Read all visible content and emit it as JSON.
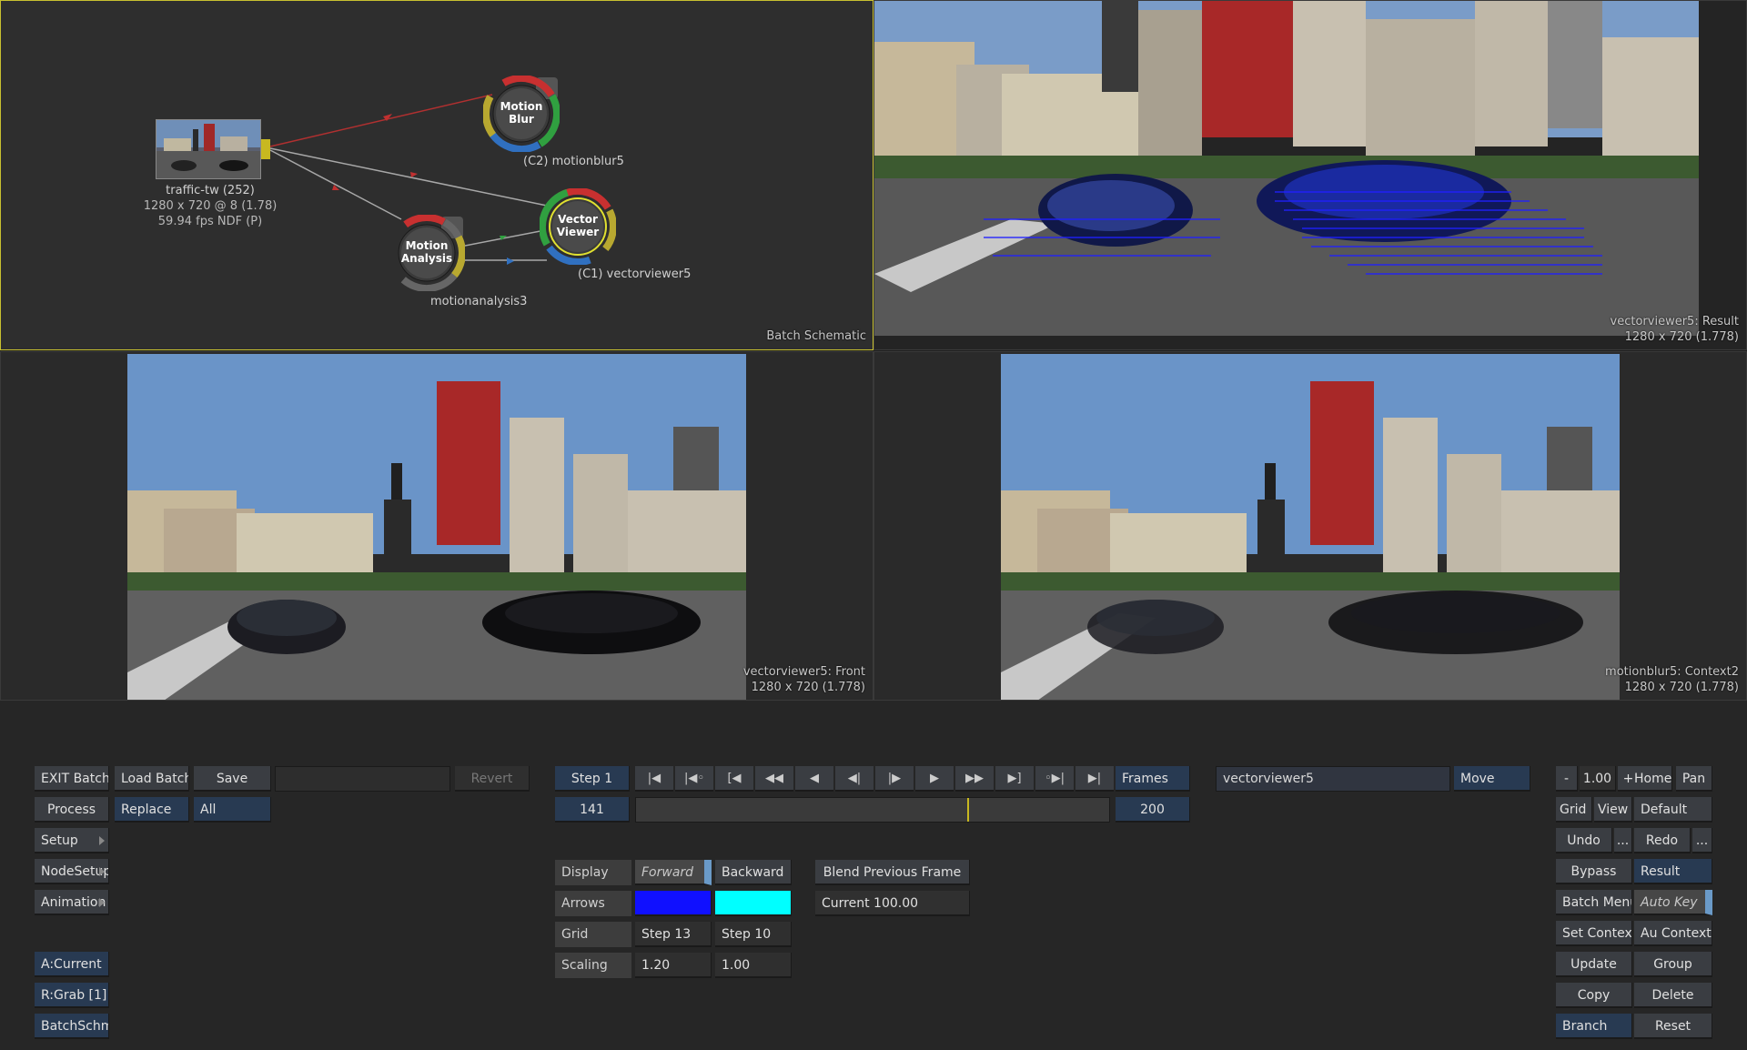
{
  "schematic": {
    "label": "Batch Schematic",
    "clip": {
      "name": "traffic-tw (252)",
      "res": "1280 x 720 @ 8 (1.78)",
      "fps": "59.94 fps NDF (P)"
    },
    "motionblur": {
      "title1": "Motion",
      "title2": "Blur",
      "label": "(C2)  motionblur5"
    },
    "vectorviewer": {
      "title1": "Vector",
      "title2": "Viewer",
      "label": "(C1)  vectorviewer5"
    },
    "motionanalysis": {
      "title1": "Motion",
      "title2": "Analysis",
      "label": "motionanalysis3"
    }
  },
  "viewports": {
    "result": {
      "name": "vectorviewer5: Result",
      "res": "1280 x 720 (1.778)"
    },
    "front": {
      "name": "vectorviewer5: Front",
      "res": "1280 x 720 (1.778)"
    },
    "context": {
      "name": "motionblur5: Context2",
      "res": "1280 x 720 (1.778)"
    }
  },
  "left_buttons": {
    "exit_batch": "EXIT Batch",
    "load_batch": "Load Batch",
    "save": "Save",
    "revert": "Revert",
    "process": "Process",
    "replace": "Replace",
    "all": "All",
    "setup": "Setup",
    "nodesetup": "NodeSetup",
    "animation": "Animation",
    "a_current": "A:Current",
    "r_grab": "R:Grab [1]",
    "batchschm": "BatchSchm"
  },
  "transport": {
    "step": "Step 1",
    "current_frame": "141",
    "end_frame": "200",
    "frames_label": "Frames",
    "progress": 0.7
  },
  "vector_controls": {
    "display_label": "Display",
    "forward": "Forward",
    "backward": "Backward",
    "arrows_label": "Arrows",
    "arrow_color_1": "#1010ff",
    "arrow_color_2": "#00ffff",
    "grid_label": "Grid",
    "grid_step_1": "Step 13",
    "grid_step_2": "Step 10",
    "scaling_label": "Scaling",
    "scaling_1": "1.20",
    "scaling_2": "1.00",
    "blend": "Blend Previous Frame",
    "current": "Current 100.00"
  },
  "node": {
    "name": "vectorviewer5",
    "move": "Move"
  },
  "right_buttons": {
    "minus": "-",
    "zoom": "1.00",
    "plus": "+",
    "home": "Home",
    "pan": "Pan",
    "grid": "Grid",
    "view": "View",
    "default": "Default",
    "undo": "Undo",
    "undo_more": "...",
    "redo": "Redo",
    "redo_more": "...",
    "bypass": "Bypass",
    "result": "Result",
    "batch_menu": "Batch Menu",
    "auto_key": "Auto Key",
    "set_context": "Set Context",
    "au_context": "Au Context",
    "update": "Update",
    "group": "Group",
    "copy": "Copy",
    "delete": "Delete",
    "branch": "Branch",
    "reset": "Reset"
  }
}
